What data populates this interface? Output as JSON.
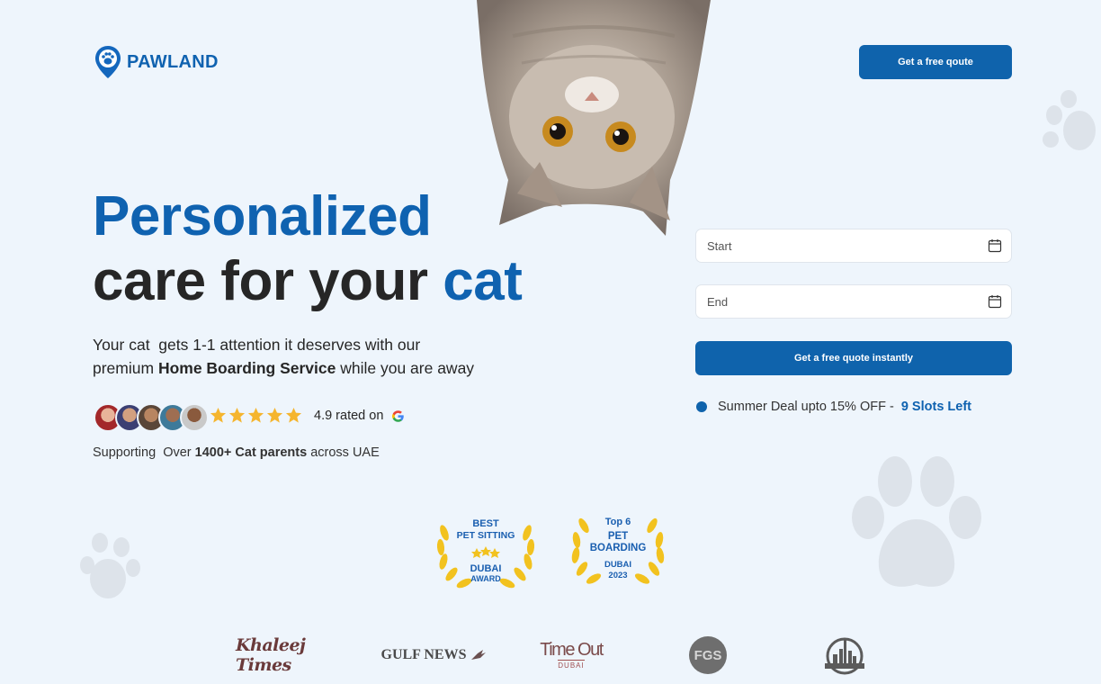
{
  "brand": {
    "name": "PAWLAND",
    "color": "#0f62b0"
  },
  "header": {
    "cta_label": "Get a free qoute"
  },
  "hero": {
    "headline_line1": "Personalized",
    "headline_line2_a": "care for your ",
    "headline_line2_b": "cat",
    "subtext_line1": "Your cat  gets 1-1 attention it deserves with our",
    "subtext_line2_a": "premium ",
    "subtext_line2_bold": "Home Boarding Service",
    "subtext_line2_b": " while you are away",
    "rating_text": "4.9 rated on",
    "rating_stars": 5,
    "support_a": "Supporting  Over ",
    "support_bold": "1400+ Cat parents",
    "support_b": " across UAE"
  },
  "booking": {
    "start_placeholder": "Start",
    "end_placeholder": "End",
    "submit_label": "Get a free quote instantly",
    "deal_text": "Summer Deal upto 15% OFF - ",
    "deal_highlight": "9 Slots Left"
  },
  "awards": [
    {
      "line1": "BEST",
      "line2": "PET SITTING",
      "line3": "DUBAI",
      "line4": "AWARD"
    },
    {
      "line1": "Top 6",
      "line2": "PET",
      "line3": "BOARDING",
      "line4": "DUBAI",
      "line5": "2023"
    }
  ],
  "press": {
    "khaleej": "Khaleej Times",
    "gulf": "GULF NEWS",
    "timeout_a": "Time Out",
    "timeout_b": "DUBAI",
    "fgs": "FGS"
  },
  "colors": {
    "accent": "#0f63ac",
    "background": "#eef5fc",
    "star": "#f5b52e",
    "paw": "#dde3ea"
  }
}
